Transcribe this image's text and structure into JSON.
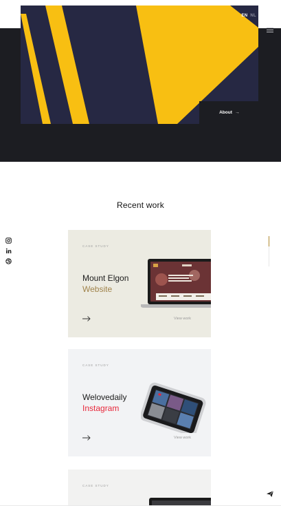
{
  "header": {
    "languages": [
      {
        "code": "EN",
        "active": true
      },
      {
        "code": "NL",
        "active": false
      }
    ],
    "menu_icon": "hamburger-icon",
    "about_label": "About",
    "about_icon": "arrow-right-icon"
  },
  "colors": {
    "dark": "#1c1d22",
    "hero_navy": "#262843",
    "hero_yellow": "#f8bf12",
    "accent_gold": "#a0834b",
    "accent_red": "#e8273a"
  },
  "recent_work": {
    "title": "Recent work",
    "progress": 0.33,
    "cards": [
      {
        "kicker": "CASE STUDY",
        "title_line1": "Mount Elgon",
        "title_line2": "Website",
        "title_line2_color": "#a0834b",
        "background": "#ecebe2",
        "mockup": "laptop",
        "view_label": "View work"
      },
      {
        "kicker": "CASE STUDY",
        "title_line1": "Welovedaily",
        "title_line2": "Instagram",
        "title_line2_color": "#e8273a",
        "background": "#f2f3f5",
        "mockup": "phone",
        "view_label": "View work"
      },
      {
        "kicker": "CASE STUDY",
        "background": "#f2f2f1",
        "mockup": "laptop"
      }
    ]
  },
  "social": [
    {
      "name": "instagram-icon"
    },
    {
      "name": "linkedin-icon"
    },
    {
      "name": "dribbble-icon"
    }
  ],
  "floating": {
    "icon": "paper-plane-icon"
  }
}
